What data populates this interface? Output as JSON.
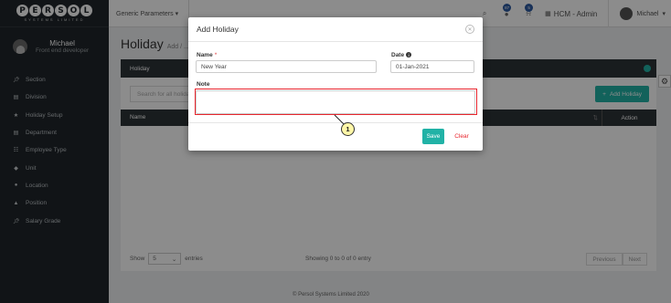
{
  "sidebar": {
    "logo_letters": [
      "P",
      "E",
      "R",
      "S",
      "O",
      "L"
    ],
    "logo_subtitle": "SYSTEMS LIMITED",
    "user_name": "Michael",
    "user_role": "Front end developer",
    "items": [
      {
        "label": "Section",
        "icon": "pin-icon"
      },
      {
        "label": "Division",
        "icon": "document-icon"
      },
      {
        "label": "Holiday Setup",
        "icon": "star-icon"
      },
      {
        "label": "Department",
        "icon": "document-icon"
      },
      {
        "label": "Employee Type",
        "icon": "people-icon"
      },
      {
        "label": "Unit",
        "icon": "tag-icon"
      },
      {
        "label": "Location",
        "icon": "location-icon"
      },
      {
        "label": "Position",
        "icon": "graduation-cap-icon"
      },
      {
        "label": "Salary Grade",
        "icon": "pin-icon"
      }
    ]
  },
  "topbar": {
    "menu_label": "Generic Parameters",
    "badge_messages": "87",
    "badge_notifications": "5",
    "app_label": "HCM - Admin",
    "user_label": "Michael"
  },
  "page": {
    "title": "Holiday",
    "subtitle": "Add / ..."
  },
  "panel": {
    "title": "Holiday",
    "search_placeholder": "Search for all holida",
    "add_button": "Add Holiday",
    "col_name": "Name",
    "col_action": "Action",
    "show_label": "Show",
    "show_value": "5",
    "entries_label": "entries",
    "info": "Showing 0 to 0 of 0 entry",
    "prev": "Previous",
    "next": "Next"
  },
  "footer": {
    "copyright": "© Persol Systems Limited 2020"
  },
  "modal": {
    "title": "Add Holiday",
    "name_label": "Name",
    "name_required": "*",
    "name_value": "New Year",
    "date_label": "Date",
    "date_value": "01-Jan-2021",
    "note_label": "Note",
    "note_value": "",
    "save_label": "Save",
    "clear_label": "Clear"
  },
  "callout": {
    "number": "1",
    "color": "#e8252d"
  }
}
